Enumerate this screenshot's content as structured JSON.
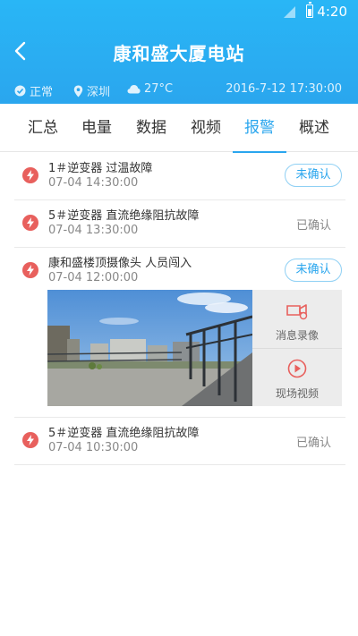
{
  "statusbar": {
    "time": "4:20"
  },
  "header": {
    "title": "康和盛大厦电站",
    "status": "正常",
    "location": "深圳",
    "temperature": "27°C",
    "datetime": "2016-7-12 17:30:00"
  },
  "tabs": [
    {
      "label": "汇总"
    },
    {
      "label": "电量"
    },
    {
      "label": "数据"
    },
    {
      "label": "视频"
    },
    {
      "label": "报警",
      "active": true
    },
    {
      "label": "概述"
    }
  ],
  "alarms": [
    {
      "title": "1＃逆变器  过温故障",
      "time": "07-04  14:30:00",
      "state": "未确认"
    },
    {
      "title": "5＃逆变器  直流绝缘阻抗故障",
      "time": "07-04  13:30:00",
      "state": "已确认"
    },
    {
      "title": "康和盛楼顶摄像头  人员闯入",
      "time": "07-04  12:00:00",
      "state": "未确认"
    },
    {
      "title": "5＃逆变器  直流绝缘阻抗故障",
      "time": "07-04  10:30:00",
      "state": "已确认"
    }
  ],
  "media": {
    "record_label": "消息录像",
    "live_label": "现场视频"
  },
  "colors": {
    "accent": "#2aa6ee",
    "alarm_icon": "#e8605d"
  }
}
